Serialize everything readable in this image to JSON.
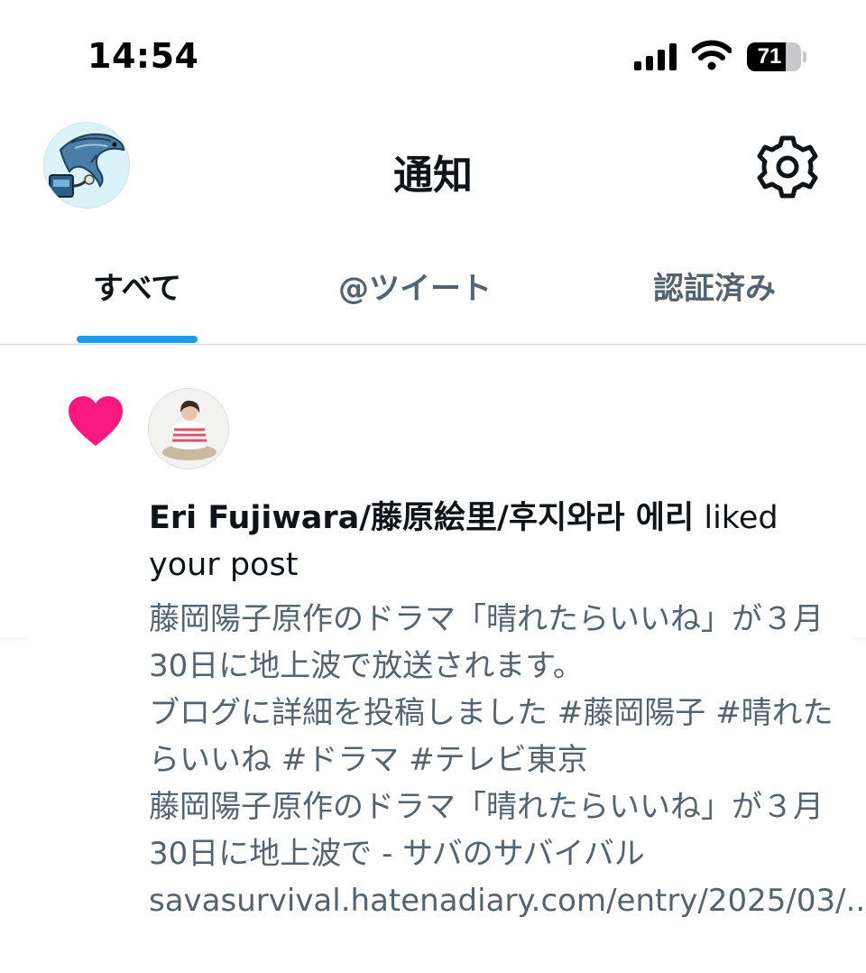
{
  "status_bar": {
    "time": "14:54",
    "battery_percent": "71",
    "battery_level": 0.71,
    "icons": [
      "cellular-signal-icon",
      "wifi-icon",
      "battery-icon"
    ]
  },
  "header": {
    "title": "通知",
    "avatar_icon": "fish-avatar",
    "settings_icon": "gear-icon"
  },
  "tabs": [
    {
      "label": "すべて",
      "selected": true
    },
    {
      "label": "@ツイート",
      "selected": false
    },
    {
      "label": "認証済み",
      "selected": false
    }
  ],
  "notification": {
    "type_icon": "heart-icon",
    "user_name": "Eri Fujiwara/藤原絵里/후지와라 에리",
    "action": " liked your post",
    "post_text": "藤岡陽子原作のドラマ「晴れたらいいね」が３月30日に地上波で放送されます。\nブログに詳細を投稿しました #藤岡陽子 #晴れたらいいね #ドラマ #テレビ東京\n藤岡陽子原作のドラマ「晴れたらいいね」が３月30日に地上波で - サバのサバイバル\nsavasurvival.hatenadiary.com/entry/2025/03/..."
  },
  "colors": {
    "accent": "#1d9bf0",
    "like": "#f91880",
    "secondary_text": "#536471",
    "primary_text": "#0f1419"
  }
}
